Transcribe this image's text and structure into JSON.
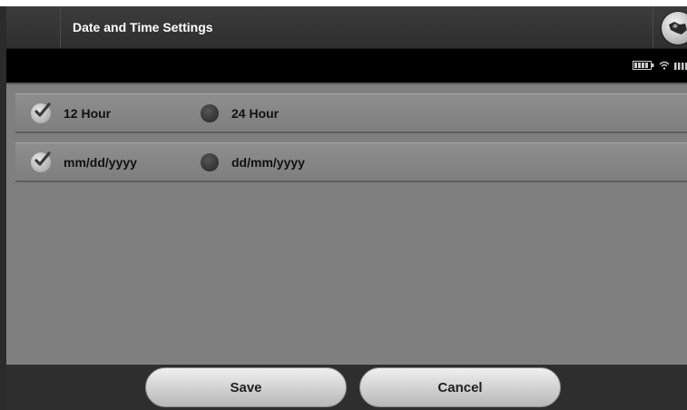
{
  "header": {
    "title": "Date and Time Settings",
    "app_icon": "globe-icon"
  },
  "status_bar": {
    "icons": [
      "battery-icon",
      "wifi-icon",
      "signal-icon"
    ]
  },
  "time_format": {
    "options": [
      {
        "label": "12 Hour",
        "selected": true
      },
      {
        "label": "24 Hour",
        "selected": false
      }
    ]
  },
  "date_format": {
    "options": [
      {
        "label": "mm/dd/yyyy",
        "selected": true
      },
      {
        "label": "dd/mm/yyyy",
        "selected": false
      }
    ]
  },
  "footer": {
    "save_label": "Save",
    "cancel_label": "Cancel"
  }
}
